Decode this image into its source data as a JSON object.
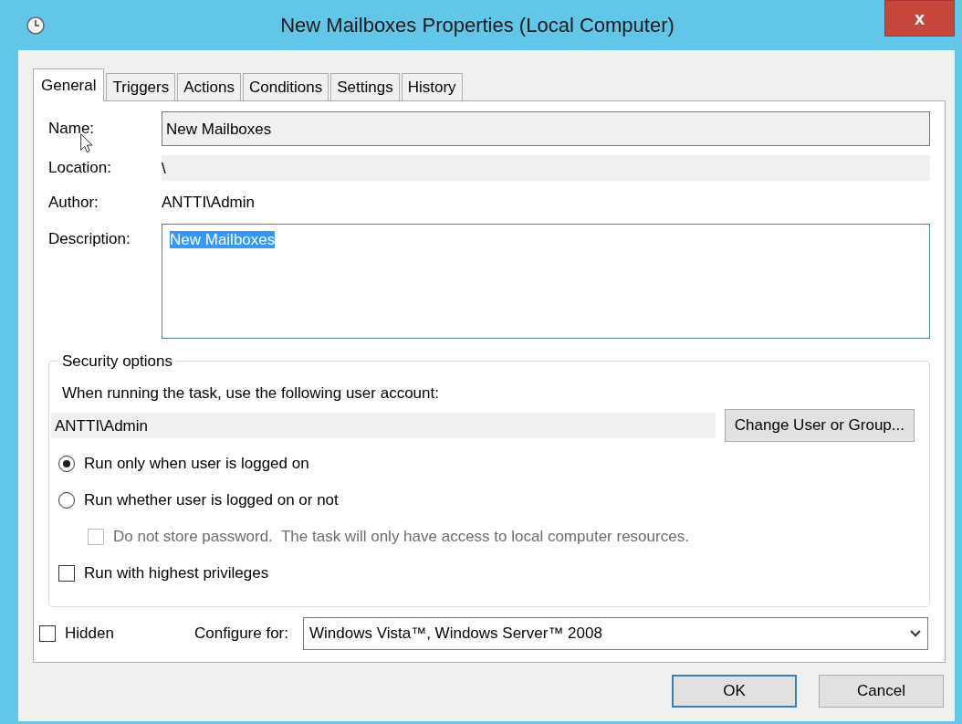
{
  "window": {
    "title": "New Mailboxes Properties (Local Computer)",
    "close": "x"
  },
  "tabs": [
    {
      "label": "General",
      "selected": true
    },
    {
      "label": "Triggers",
      "selected": false
    },
    {
      "label": "Actions",
      "selected": false
    },
    {
      "label": "Conditions",
      "selected": false
    },
    {
      "label": "Settings",
      "selected": false
    },
    {
      "label": "History",
      "selected": false
    }
  ],
  "general": {
    "name": {
      "label": "Name:",
      "value": "New Mailboxes"
    },
    "location": {
      "label": "Location:",
      "value": "\\"
    },
    "author": {
      "label": "Author:",
      "value": "ANTTI\\Admin"
    },
    "description": {
      "label": "Description:",
      "value": "New Mailboxes",
      "highlighted": true
    }
  },
  "security": {
    "legend": "Security options",
    "prompt": "When running the task, use the following user account:",
    "account": "ANTTI\\Admin",
    "change_button": "Change User or Group...",
    "options": [
      {
        "kind": "radio",
        "label": "Run only when user is logged on",
        "selected": true
      },
      {
        "kind": "radio",
        "label": "Run whether user is logged on or not",
        "selected": false,
        "children": [
          {
            "kind": "checkbox",
            "label": "Do not store password.  The task will only have access to local computer resources.",
            "checked": false,
            "disabled": true
          }
        ]
      },
      {
        "kind": "checkbox",
        "label": "Run with highest privileges",
        "checked": false,
        "disabled": false
      }
    ]
  },
  "hidden": {
    "label": "Hidden",
    "checked": false
  },
  "configure_for": {
    "label": "Configure for:",
    "value": "Windows Vista™, Windows Server™ 2008"
  },
  "buttons": [
    {
      "label": "OK",
      "default": true
    },
    {
      "label": "Cancel",
      "default": false
    }
  ]
}
